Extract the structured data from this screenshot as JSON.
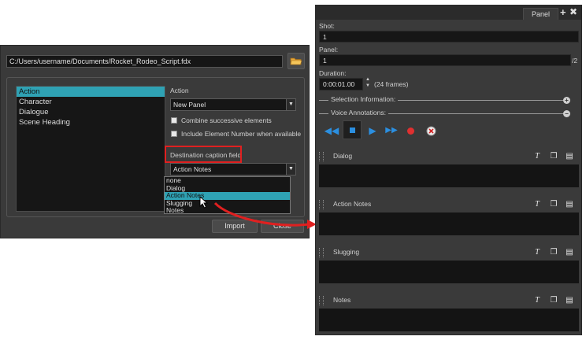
{
  "dialog": {
    "path": "C:/Users/username/Documents/Rocket_Rodeo_Script.fdx",
    "elements": [
      "Action",
      "Character",
      "Dialogue",
      "Scene Heading"
    ],
    "selected_element": "Action",
    "action_label": "Action",
    "action_value": "New Panel",
    "combine_label": "Combine successive elements",
    "include_number_label": "Include Element Number when available",
    "dest_label": "Destination caption field",
    "dest_value": "Action Notes",
    "dest_options": [
      "none",
      "Dialog",
      "Action Notes",
      "Slugging",
      "Notes"
    ],
    "dest_selected": "Action Notes",
    "import_label": "Import",
    "close_label": "Close"
  },
  "panel": {
    "tab_label": "Panel",
    "shot_label": "Shot:",
    "shot_value": "1",
    "panel_label": "Panel:",
    "panel_value": "1",
    "panel_total": "/2",
    "duration_label": "Duration:",
    "duration_value": "0:00:01.00",
    "duration_frames": "(24 frames)",
    "selection_info_label": "Selection Information:",
    "voice_annotations_label": "Voice Annotations:",
    "captions": [
      "Dialog",
      "Action Notes",
      "Slugging",
      "Notes"
    ]
  },
  "colors": {
    "highlight_teal": "#2fa2b4",
    "callout_red": "#e02020",
    "play_blue": "#2b8fe0",
    "record_red": "#e03030"
  },
  "icons": {
    "folder": "folder-icon",
    "rewind": "rewind-icon",
    "stop": "stop-icon",
    "play": "play-icon",
    "fast_forward": "fast-forward-icon",
    "record": "record-icon",
    "delete": "delete-icon",
    "text_tool": "text-tool-icon",
    "copy": "copy-icon",
    "menu": "caption-menu-icon"
  }
}
